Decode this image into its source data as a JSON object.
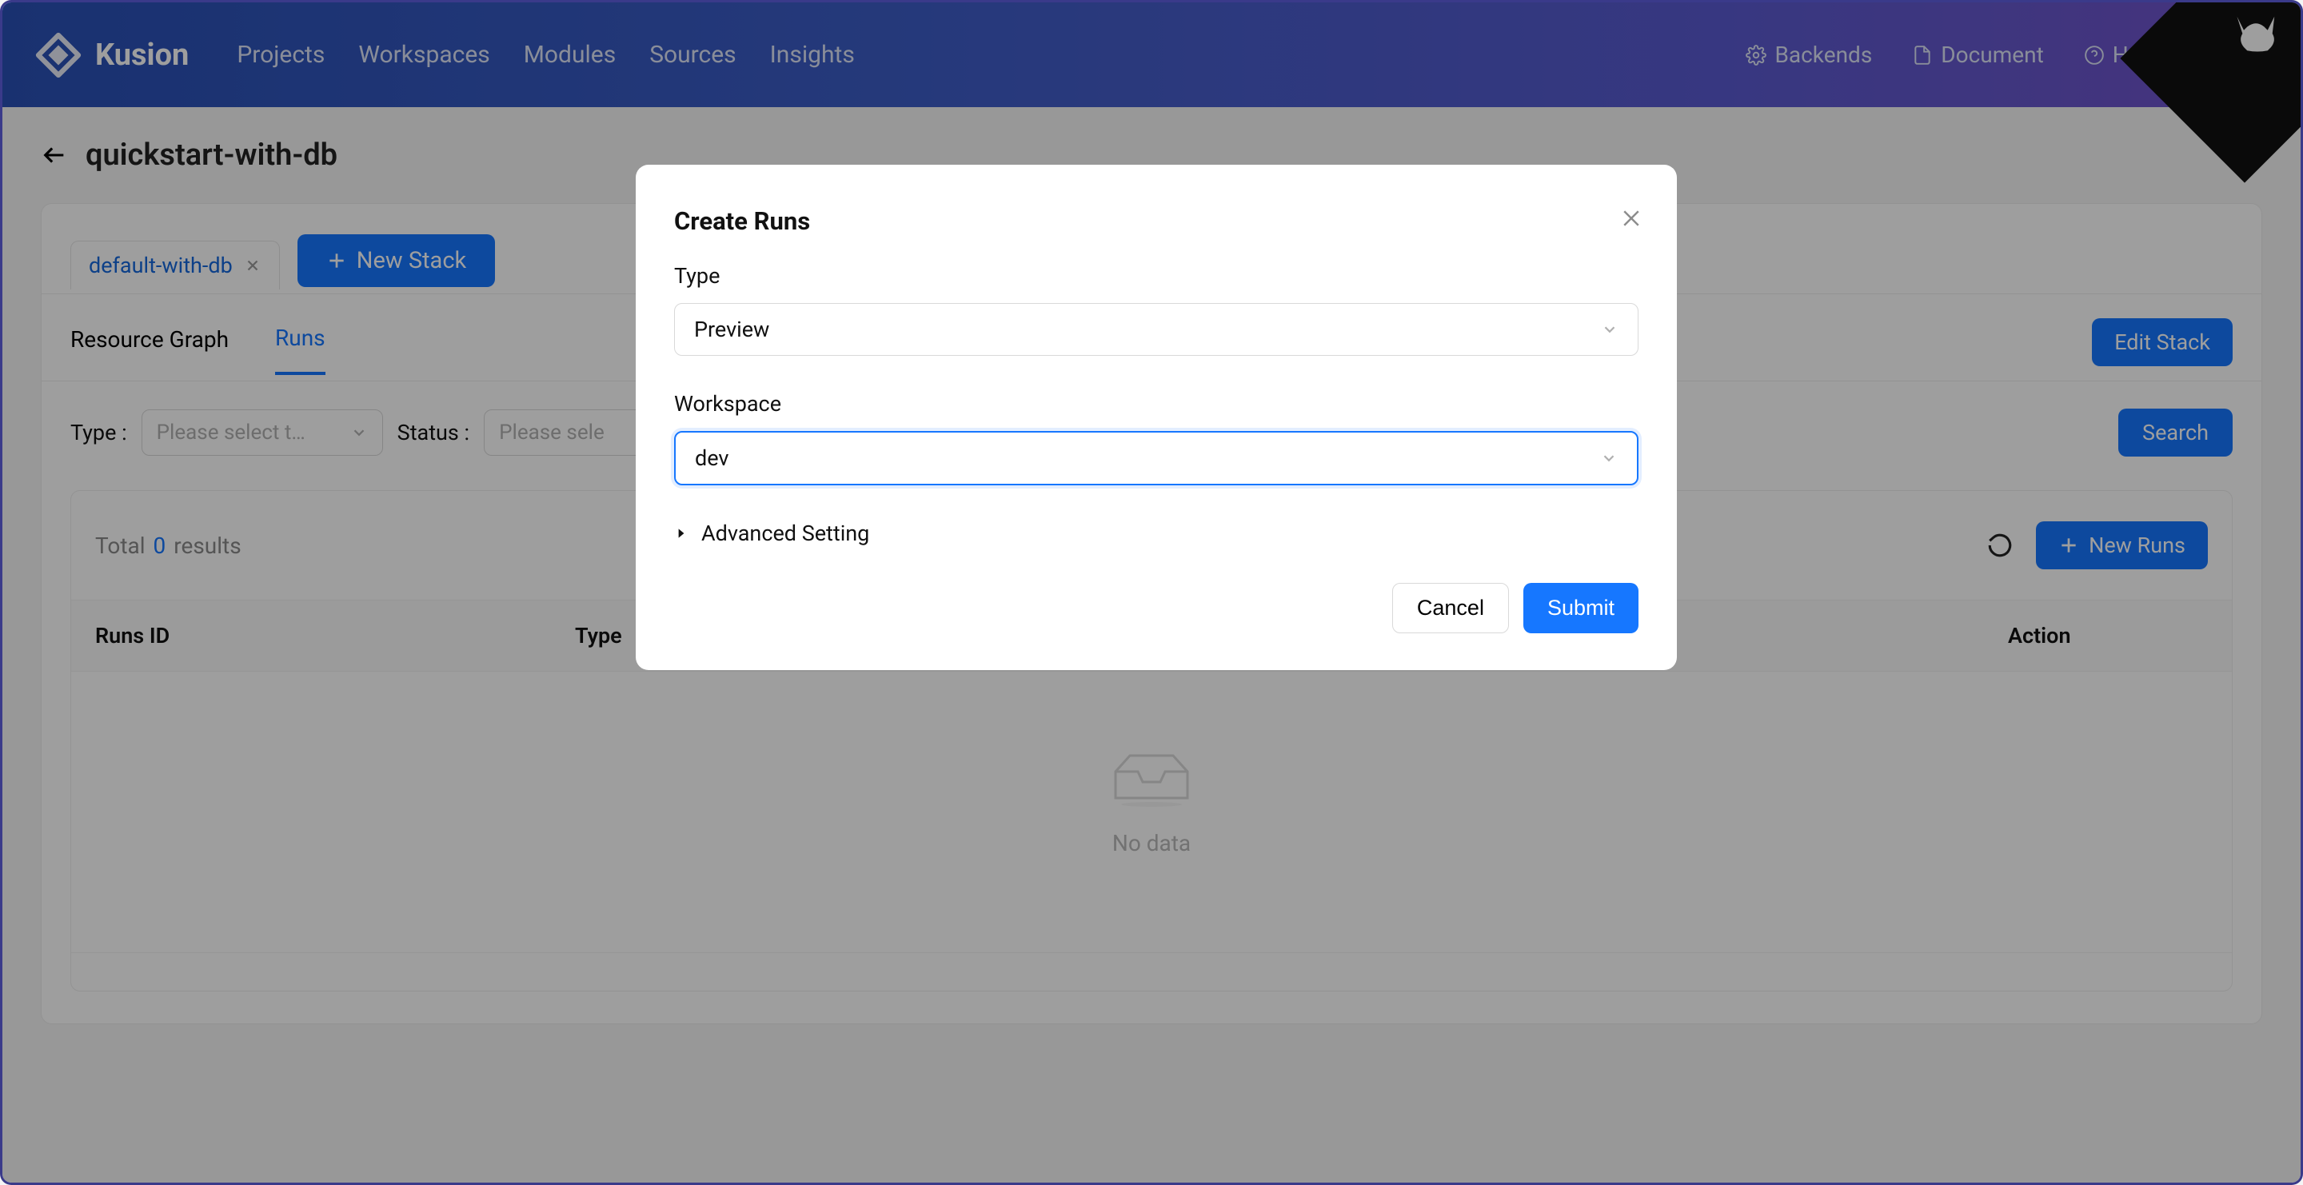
{
  "header": {
    "brand": "Kusion",
    "nav": [
      "Projects",
      "Workspaces",
      "Modules",
      "Sources",
      "Insights"
    ],
    "right": {
      "backends": "Backends",
      "document": "Document",
      "help": "Help&Feedback"
    }
  },
  "page": {
    "title": "quickstart-with-db"
  },
  "stack_tabs": {
    "active_tab": "default-with-db",
    "new_stack": "New Stack"
  },
  "sub_tabs": {
    "items": [
      "Resource Graph",
      "Runs"
    ],
    "edit_stack": "Edit Stack"
  },
  "filters": {
    "type_label": "Type :",
    "type_placeholder": "Please select t…",
    "status_label": "Status :",
    "status_placeholder": "Please sele",
    "search": "Search"
  },
  "results": {
    "total_prefix": "Total",
    "total_count": "0",
    "total_suffix": "results",
    "new_runs": "New Runs",
    "columns": {
      "id": "Runs ID",
      "type": "Type",
      "action": "Action"
    },
    "empty": "No data"
  },
  "modal": {
    "title": "Create Runs",
    "type_label": "Type",
    "type_value": "Preview",
    "workspace_label": "Workspace",
    "workspace_value": "dev",
    "advanced": "Advanced Setting",
    "cancel": "Cancel",
    "submit": "Submit"
  }
}
